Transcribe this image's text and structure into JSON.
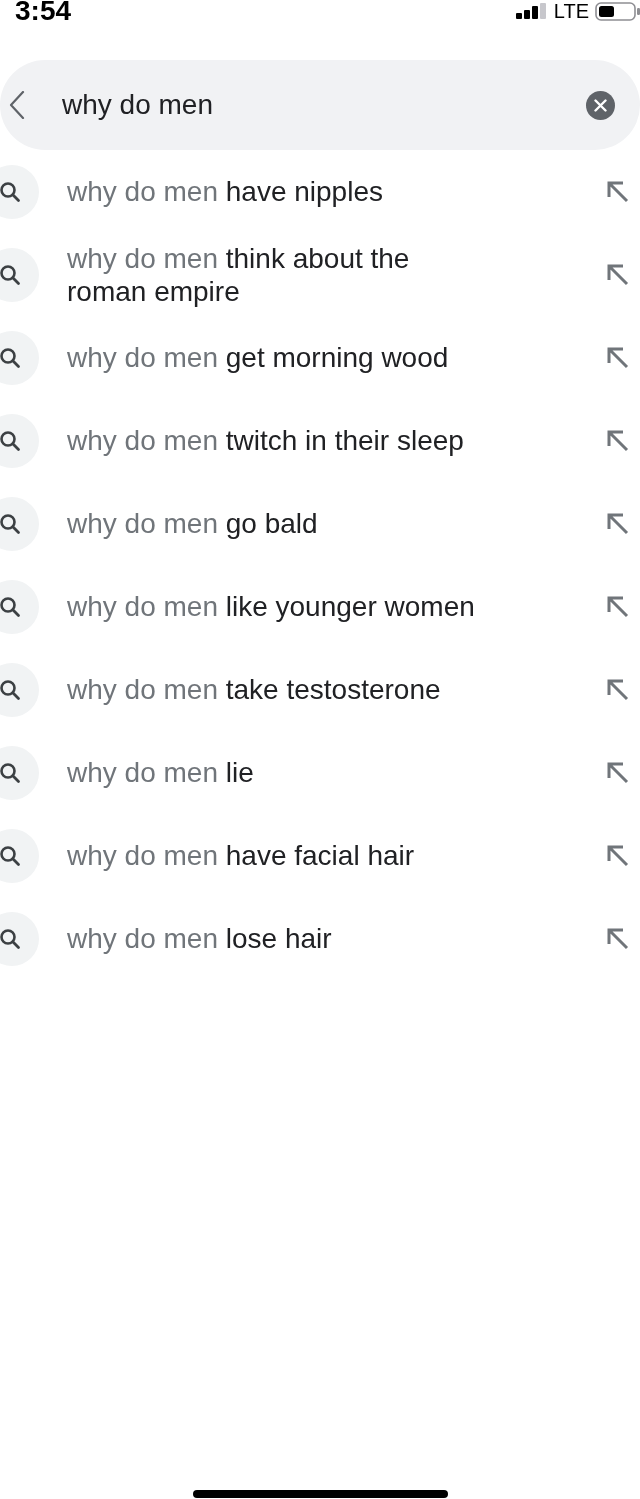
{
  "status_bar": {
    "time": "3:54",
    "network": "LTE"
  },
  "search": {
    "value": "why do men"
  },
  "suggestions": [
    {
      "prefix": "why do men",
      "completion": "have nipples"
    },
    {
      "prefix": "why do men",
      "completion": "think about the roman empire"
    },
    {
      "prefix": "why do men",
      "completion": "get morning wood"
    },
    {
      "prefix": "why do men",
      "completion": "twitch in their sleep"
    },
    {
      "prefix": "why do men",
      "completion": "go bald"
    },
    {
      "prefix": "why do men",
      "completion": "like younger women"
    },
    {
      "prefix": "why do men",
      "completion": "take testosterone"
    },
    {
      "prefix": "why do men",
      "completion": "lie"
    },
    {
      "prefix": "why do men",
      "completion": "have facial hair"
    },
    {
      "prefix": "why do men",
      "completion": "lose hair"
    }
  ]
}
